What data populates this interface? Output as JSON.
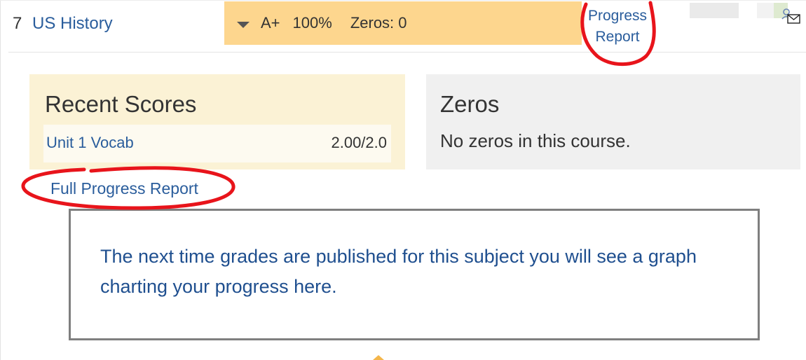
{
  "course": {
    "period": "7",
    "name": "US History",
    "grade_letter": "A+",
    "grade_percent": "100%",
    "zeros_summary": "Zeros: 0",
    "progress_report_line1": "Progress",
    "progress_report_line2": "Report",
    "header_color": "#fdd68e",
    "link_color": "#2a5d9c"
  },
  "recent_scores": {
    "title": "Recent Scores",
    "items": [
      {
        "name": "Unit 1 Vocab",
        "score": "2.00/2.0"
      }
    ],
    "full_report_link": "Full Progress Report"
  },
  "zeros": {
    "title": "Zeros",
    "message": "No zeros in this course."
  },
  "graph": {
    "message": "The next time grades are published for this subject you will see a graph charting your progress here."
  },
  "icons": [
    "chevron-down-icon",
    "email-icon"
  ]
}
